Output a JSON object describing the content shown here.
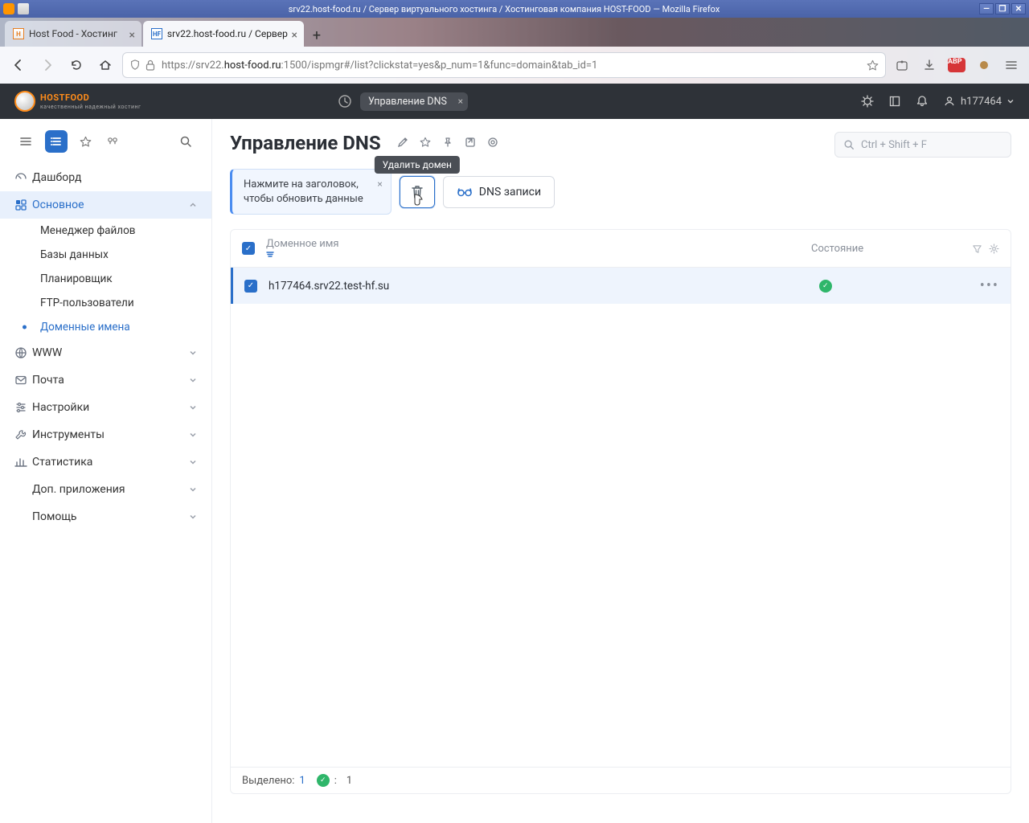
{
  "os": {
    "title": "srv22.host-food.ru / Сервер виртуального хостинга / Хостинговая компания HOST-FOOD — Mozilla Firefox"
  },
  "browser": {
    "tabs": [
      {
        "label": "Host Food - Хостинг",
        "favicon": "HF"
      },
      {
        "label": "srv22.host-food.ru / Сервер",
        "favicon": "HF"
      }
    ],
    "url_proto": "https://",
    "url_host_pre": "srv22.",
    "url_host_strong": "host-food.ru",
    "url_rest": ":1500/ispmgr#/list?clickstat=yes&p_num=1&func=domain&tab_id=1"
  },
  "topbar": {
    "logo_main": "HOSTFOOD",
    "logo_sub": "качественный надежный хостинг",
    "tab": "Управление DNS",
    "user": "h177464"
  },
  "sidebar": {
    "items": {
      "dashboard": "Дашборд",
      "basic": "Основное",
      "files": "Менеджер файлов",
      "db": "Базы данных",
      "sched": "Планировщик",
      "ftp": "FTP-пользователи",
      "domains": "Доменные имена",
      "www": "WWW",
      "mail": "Почта",
      "settings": "Настройки",
      "tools": "Инструменты",
      "stats": "Статистика",
      "addons": "Доп. приложения",
      "help": "Помощь"
    }
  },
  "page": {
    "title": "Управление DNS",
    "search_placeholder": "Ctrl + Shift + F",
    "hint_l1": "Нажмите на заголовок,",
    "hint_l2": "чтобы обновить данные",
    "tooltip_delete": "Удалить домен",
    "dns_records_btn": "DNS записи",
    "columns": {
      "domain": "Доменное имя",
      "state": "Состояние"
    },
    "rows": [
      {
        "domain": "h177464.srv22.test-hf.su",
        "state": "ok"
      }
    ],
    "footer": {
      "selected_label": "Выделено:",
      "selected_count": "1",
      "status_count": "1",
      "colon": ":"
    }
  }
}
